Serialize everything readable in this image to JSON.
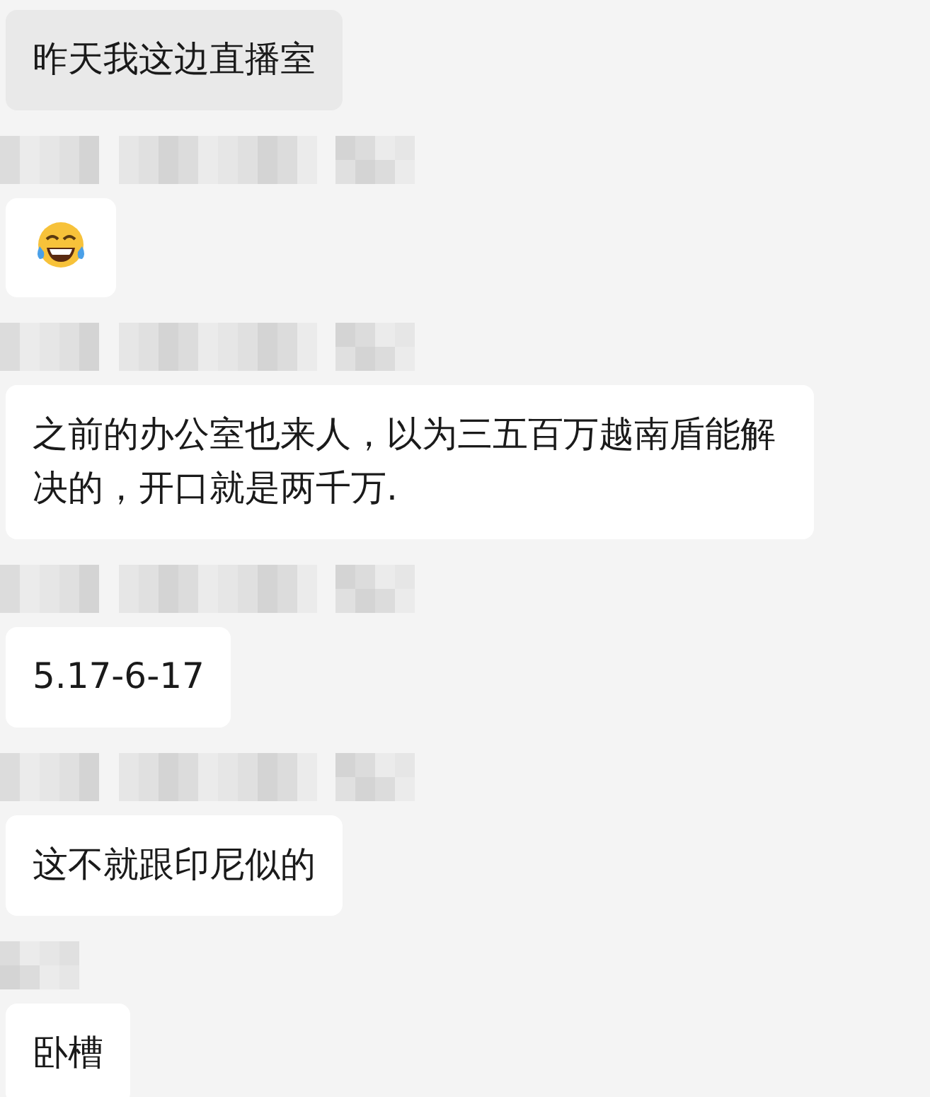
{
  "messages": [
    {
      "kind": "text",
      "highlighted": true,
      "text": "昨天我这边直播室"
    },
    {
      "kind": "emoji",
      "highlighted": false,
      "sender": {
        "kind": "long"
      }
    },
    {
      "kind": "text",
      "highlighted": false,
      "sender": {
        "kind": "long"
      },
      "text": "之前的办公室也来人，以为三五百万越南盾能解决的，开口就是两千万."
    },
    {
      "kind": "text",
      "highlighted": false,
      "sender": {
        "kind": "long"
      },
      "text": "5.17-6-17"
    },
    {
      "kind": "text",
      "highlighted": false,
      "sender": {
        "kind": "long"
      },
      "text": "这不就跟印尼似的"
    },
    {
      "kind": "text",
      "highlighted": false,
      "sender": {
        "kind": "short"
      },
      "text": "卧槽"
    }
  ]
}
